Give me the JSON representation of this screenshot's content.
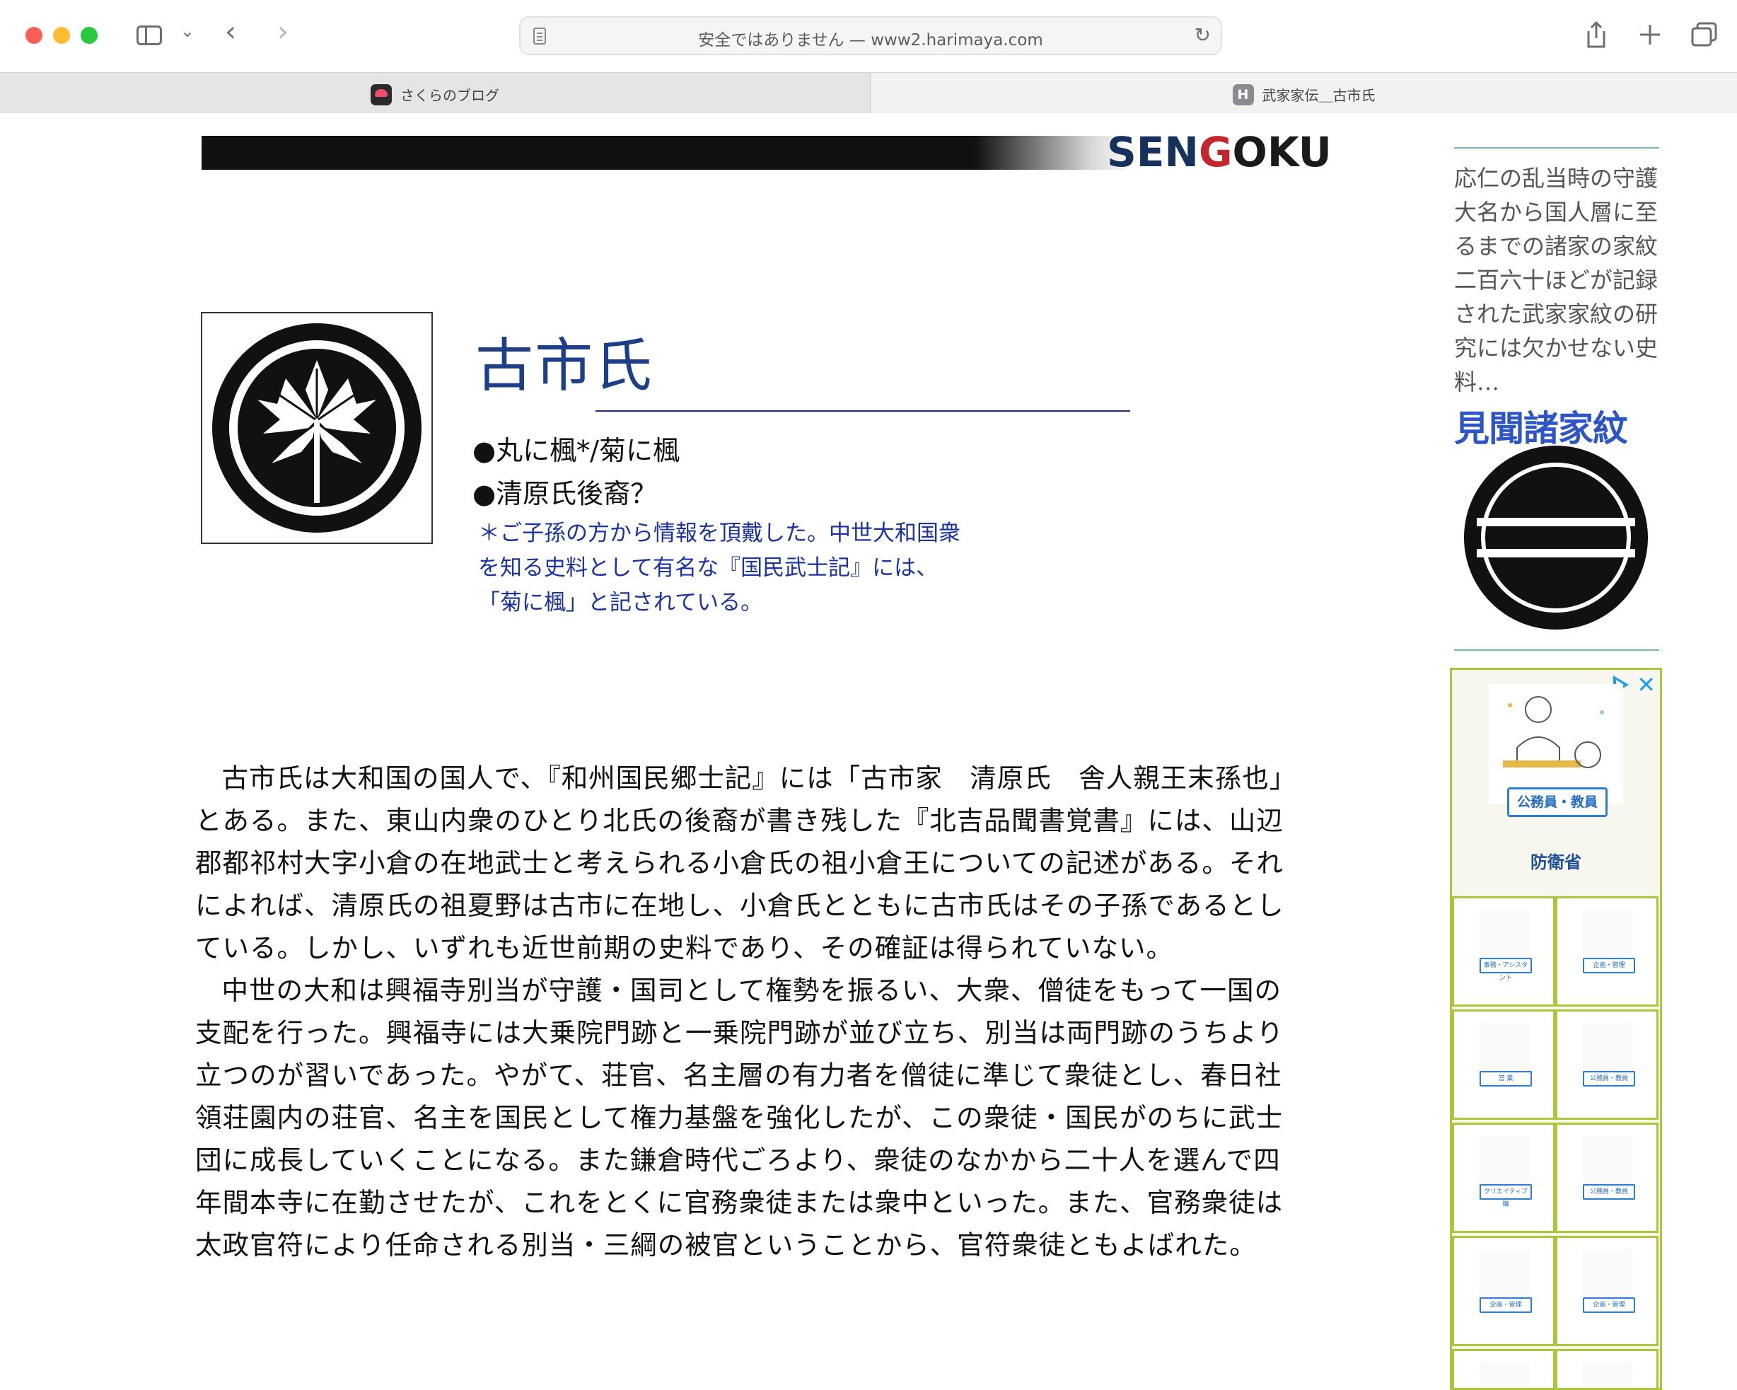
{
  "browser": {
    "address": "安全ではありません — www2.harimaya.com",
    "tabs": [
      {
        "label": "さくらのブログ"
      },
      {
        "label": "武家家伝＿古市氏"
      }
    ]
  },
  "banner": {
    "part1": "SEN",
    "part2": "G",
    "part3": "OKU"
  },
  "page": {
    "title": "古市氏",
    "bullets": [
      "●丸に楓*/菊に楓",
      "●清原氏後裔？"
    ],
    "note_lines": [
      "＊ご子孫の方から情報を頂戴した。中世大和国衆",
      "を知る史料として有名な『国民武士記』には、",
      "「菊に楓」と記されている。"
    ],
    "paragraphs": [
      "古市氏は大和国の国人で、『和州国民郷士記』には「古市家　清原氏　舎人親王末孫也」とある。また、東山内衆のひとり北氏の後裔が書き残した『北吉品聞書覚書』には、山辺郡都祁村大字小倉の在地武士と考えられる小倉氏の祖小倉王についての記述がある。それによれば、清原氏の祖夏野は古市に在地し、小倉氏とともに古市氏はその子孫であるとしている。しかし、いずれも近世前期の史料であり、その確証は得られていない。",
      "中世の大和は興福寺別当が守護・国司として権勢を振るい、大衆、僧徒をもって一国の支配を行った。興福寺には大乗院門跡と一乗院門跡が並び立ち、別当は両門跡のうちより立つのが習いであった。やがて、荘官、名主層の有力者を僧徒に準じて衆徒とし、春日社領荘園内の荘官、名主を国民として権力基盤を強化したが、この衆徒・国民がのちに武士団に成長していくことになる。また鎌倉時代ごろより、衆徒のなかから二十人を選んで四年間本寺に在勤させたが、これをとくに官務衆徒または衆中といった。また、官務衆徒は太政官符により任命される別当・三綱の被官ということから、官符衆徒ともよばれた。"
    ]
  },
  "sidebar": {
    "description": "応仁の乱当時の守護大名から国人層に至るまでの諸家の家紋 二百六十ほどが記録された武家家紋の研究には欠かせない史料…",
    "logo": "見聞諸家紋"
  },
  "ad": {
    "tag": "公務員・教員",
    "brand": "防衛省",
    "cells": [
      "事務・アシスタント",
      "企画・管理",
      "営 業",
      "公務員・教員",
      "クリエイティブ職",
      "公務員・教員",
      "企画・管理",
      "企画・管理",
      "",
      ""
    ]
  }
}
